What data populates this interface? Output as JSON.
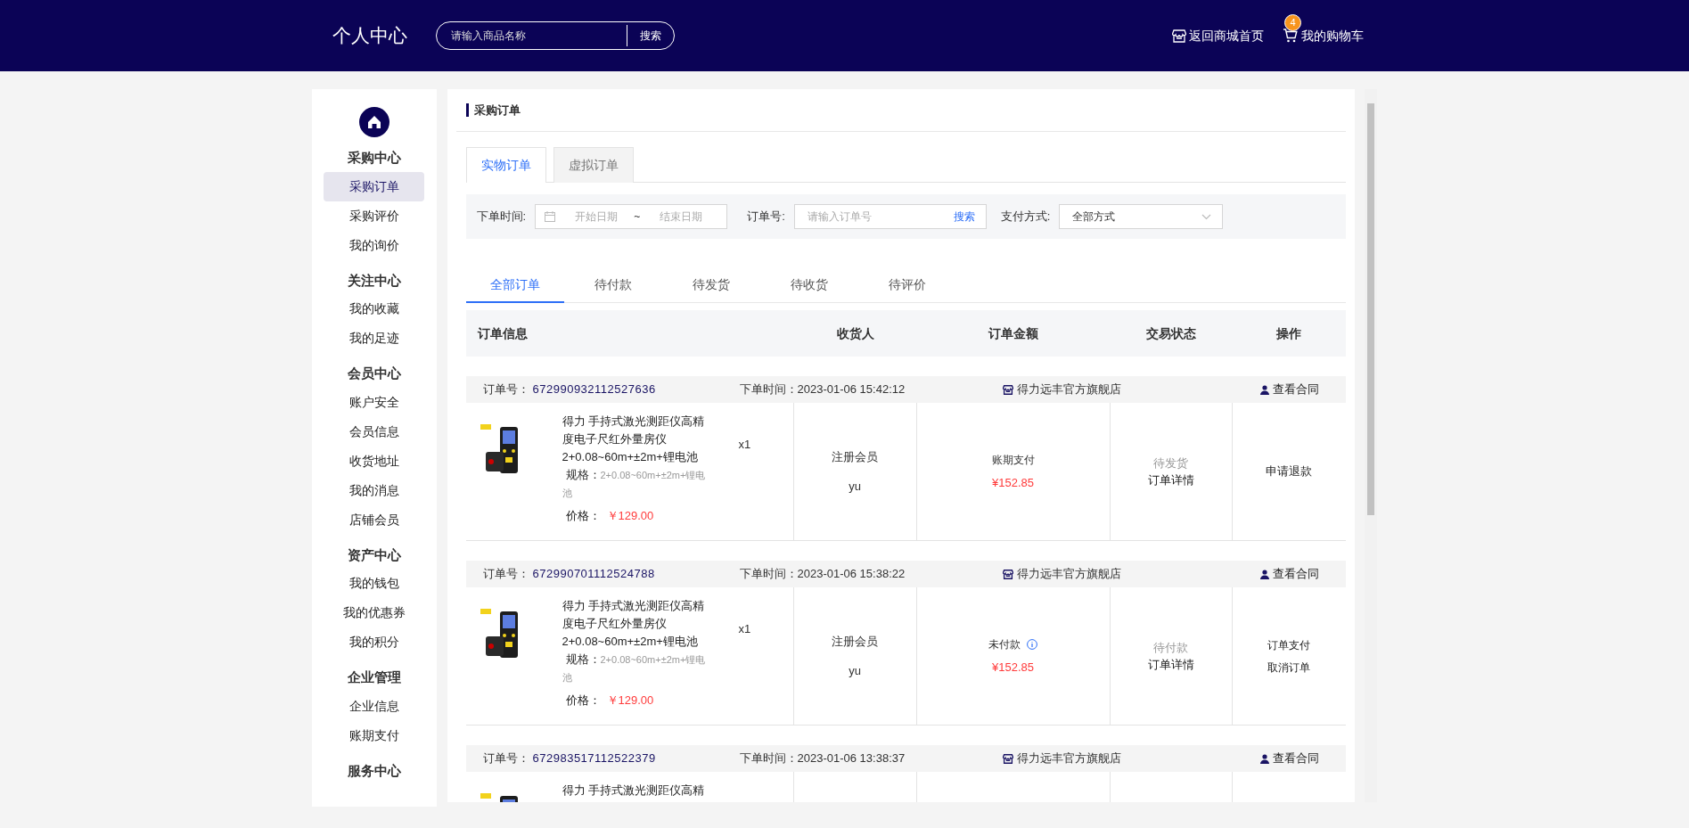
{
  "header": {
    "title": "个人中心",
    "search_placeholder": "请输入商品名称",
    "search_button": "搜索",
    "home_link": "返回商城首页",
    "cart_link": "我的购物车",
    "cart_count": "4"
  },
  "sidebar": [
    {
      "title": "采购中心",
      "items": [
        {
          "label": "采购订单",
          "selected": true
        },
        {
          "label": "采购评价",
          "selected": false
        },
        {
          "label": "我的询价",
          "selected": false
        }
      ]
    },
    {
      "title": "关注中心",
      "items": [
        {
          "label": "我的收藏",
          "selected": false
        },
        {
          "label": "我的足迹",
          "selected": false
        }
      ]
    },
    {
      "title": "会员中心",
      "items": [
        {
          "label": "账户安全",
          "selected": false
        },
        {
          "label": "会员信息",
          "selected": false
        },
        {
          "label": "收货地址",
          "selected": false
        },
        {
          "label": "我的消息",
          "selected": false
        },
        {
          "label": "店铺会员",
          "selected": false
        }
      ]
    },
    {
      "title": "资产中心",
      "items": [
        {
          "label": "我的钱包",
          "selected": false
        },
        {
          "label": "我的优惠券",
          "selected": false
        },
        {
          "label": "我的积分",
          "selected": false
        }
      ]
    },
    {
      "title": "企业管理",
      "items": [
        {
          "label": "企业信息",
          "selected": false
        },
        {
          "label": "账期支付",
          "selected": false
        }
      ]
    },
    {
      "title": "服务中心"
    }
  ],
  "page_title": "采购订单",
  "order_type_tabs": [
    {
      "label": "实物订单",
      "selected": true
    },
    {
      "label": "虚拟订单",
      "selected": false
    }
  ],
  "filters": {
    "date_label": "下单时间:",
    "start_placeholder": "开始日期",
    "separator": "~",
    "end_placeholder": "结束日期",
    "order_no_label": "订单号:",
    "order_no_placeholder": "请输入订单号",
    "search_button": "搜索",
    "payment_label": "支付方式:",
    "payment_value": "全部方式"
  },
  "status_tabs": [
    {
      "label": "全部订单",
      "selected": true
    },
    {
      "label": "待付款",
      "selected": false
    },
    {
      "label": "待发货",
      "selected": false
    },
    {
      "label": "待收货",
      "selected": false
    },
    {
      "label": "待评价",
      "selected": false
    }
  ],
  "columns": [
    "订单信息",
    "收货人",
    "订单金额",
    "交易状态",
    "操作"
  ],
  "orders": [
    {
      "order_no_label": "订单号：",
      "order_no": "672990932112527636",
      "time_label": "下单时间：",
      "time": "2023-01-06 15:42:12",
      "shop": "得力远丰官方旗舰店",
      "contract": "查看合同",
      "product": {
        "title": "得力 手持式激光测距仪高精度电子尺红外量房仪2+0.08~60m+±2m+锂电池",
        "quantity": "x1",
        "spec_label": "规格：",
        "spec": "2+0.08~60m+±2m+锂电池",
        "price_label": "价格：",
        "price": "￥129.00"
      },
      "receiver_type": "注册会员",
      "receiver": "yu",
      "payment": "账期支付",
      "payment_info": false,
      "amount": "¥152.85",
      "status": "待发货",
      "detail": "订单详情",
      "actions": [
        "申请退款"
      ]
    },
    {
      "order_no_label": "订单号：",
      "order_no": "672990701112524788",
      "time_label": "下单时间：",
      "time": "2023-01-06 15:38:22",
      "shop": "得力远丰官方旗舰店",
      "contract": "查看合同",
      "product": {
        "title": "得力 手持式激光测距仪高精度电子尺红外量房仪2+0.08~60m+±2m+锂电池",
        "quantity": "x1",
        "spec_label": "规格：",
        "spec": "2+0.08~60m+±2m+锂电池",
        "price_label": "价格：",
        "price": "￥129.00"
      },
      "receiver_type": "注册会员",
      "receiver": "yu",
      "payment": "未付款",
      "payment_info": true,
      "amount": "¥152.85",
      "status": "待付款",
      "detail": "订单详情",
      "actions": [
        "订单支付",
        "取消订单"
      ]
    },
    {
      "order_no_label": "订单号：",
      "order_no": "672983517112522379",
      "time_label": "下单时间：",
      "time": "2023-01-06 13:38:37",
      "shop": "得力远丰官方旗舰店",
      "contract": "查看合同",
      "product": {
        "title": "得力 手持式激光测距仪高精"
      }
    }
  ]
}
